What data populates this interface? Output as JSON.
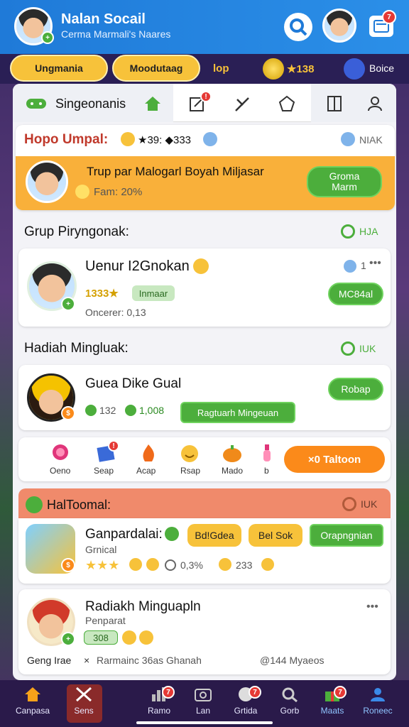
{
  "header": {
    "title": "Nalan Socail",
    "subtitle": "Cerma Marmali's Naares",
    "notif_count": "7"
  },
  "topbar": {
    "btn1": "Ungmania",
    "btn2": "Moodutaag",
    "link": "lop",
    "coins": "★138",
    "user": "Boice"
  },
  "tabs": {
    "home_label": "Singeonanis",
    "notif_count": "!"
  },
  "promo": {
    "heading": "Hopo Umpal:",
    "stats": "★39: ◆333",
    "corner": "NIAK",
    "title": "Trup par Malogarl Boyah Miljasar",
    "fan_label": "Fam: 20%",
    "button": "Groma Marm"
  },
  "section1": {
    "heading": "Grup Piryngonak:",
    "corner": "HJA"
  },
  "user1": {
    "name": "Uenur I2Gnokan",
    "score": "1333★",
    "tag": "Inmaar",
    "meta": "Oncerer: 0,13",
    "count": "1",
    "button": "MC84al"
  },
  "section2": {
    "heading": "Hadiah Mingluak:",
    "corner": "IUK"
  },
  "user2": {
    "name": "Guea Dike Gual",
    "stat1": "132",
    "stat2": "1,008",
    "action": "Ragtuarh Mingeuan",
    "button": "Robap"
  },
  "icons_row": [
    {
      "icon": "lollipop-icon",
      "label": "Oeno"
    },
    {
      "icon": "book-icon",
      "label": "Seap"
    },
    {
      "icon": "fire-icon",
      "label": "Acap"
    },
    {
      "icon": "smile-icon",
      "label": "Rsap"
    },
    {
      "icon": "pumpkin-icon",
      "label": "Mado"
    },
    {
      "icon": "potion-icon",
      "label": "b"
    }
  ],
  "icons_button": "×0 Taltoon",
  "section3": {
    "heading": "HalToomal:",
    "corner": "IUK"
  },
  "item3": {
    "name": "Ganpardalai:",
    "sub": "Grnical",
    "btn1": "Bd!Gdea",
    "btn2": "Bel Sok",
    "btn3": "Orapngnian",
    "meta1": "0,3%",
    "meta2": "233"
  },
  "item4": {
    "name": "Radiakh Minguapln",
    "sub": "Penparat",
    "tag": "308",
    "left": "Geng Irae",
    "mid": "Rarmainc 36as Ghanah",
    "right": "@144 Myaeos"
  },
  "nav": [
    {
      "icon": "home-icon",
      "label": "Canpasa",
      "badge": ""
    },
    {
      "icon": "crossed-swords-icon",
      "label": "Sens",
      "badge": ""
    },
    {
      "icon": "chart-icon",
      "label": "Ramo",
      "badge": "7"
    },
    {
      "icon": "camera-icon",
      "label": "Lan",
      "badge": ""
    },
    {
      "icon": "chat-icon",
      "label": "Grtida",
      "badge": "7"
    },
    {
      "icon": "search-icon",
      "label": "Gorb",
      "badge": ""
    },
    {
      "icon": "gift-icon",
      "label": "Maats",
      "badge": "7"
    },
    {
      "icon": "user-icon",
      "label": "Roneec",
      "badge": ""
    }
  ],
  "colors": {
    "primary": "#1f7ad8",
    "accent": "#f7c23a",
    "green": "#4cae3c",
    "orange": "#fb8a1a",
    "salmon": "#f08a6b"
  }
}
